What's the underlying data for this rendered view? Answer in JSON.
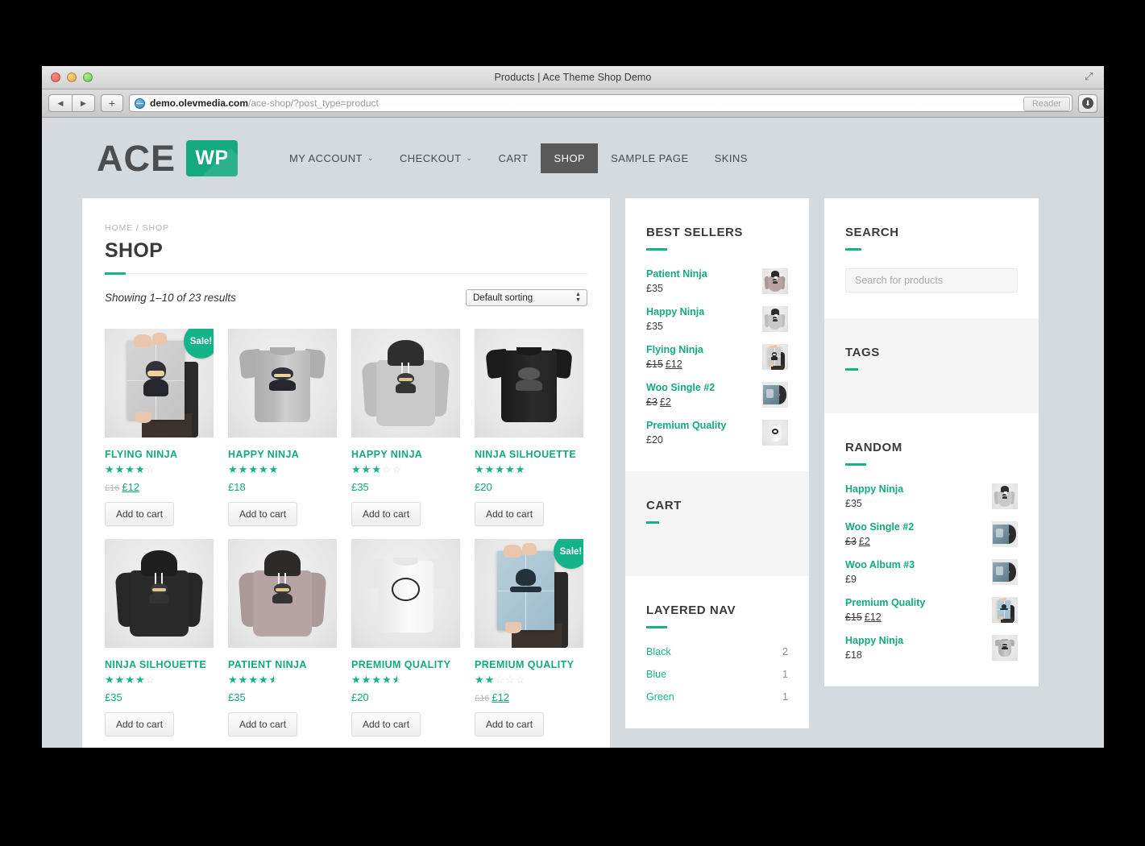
{
  "window": {
    "title": "Products | Ace Theme Shop Demo",
    "url_domain": "demo.olevmedia.com",
    "url_path": "/ace-shop/?post_type=product",
    "reader_label": "Reader",
    "reload_glyph": "↻",
    "back_glyph": "◀",
    "forward_glyph": "▶",
    "plus_glyph": "+",
    "download_glyph": "⬇",
    "resize_glyph": "⤢"
  },
  "header": {
    "logo_main": "ACE",
    "logo_badge": "WP",
    "nav": [
      {
        "label": "MY ACCOUNT",
        "has_caret": true,
        "active": false
      },
      {
        "label": "CHECKOUT",
        "has_caret": true,
        "active": false
      },
      {
        "label": "CART",
        "has_caret": false,
        "active": false
      },
      {
        "label": "SHOP",
        "has_caret": false,
        "active": true
      },
      {
        "label": "SAMPLE PAGE",
        "has_caret": false,
        "active": false
      },
      {
        "label": "SKINS",
        "has_caret": false,
        "active": false
      }
    ],
    "caret_glyph": "⌄"
  },
  "shop": {
    "breadcrumb": "HOME / SHOP",
    "title": "SHOP",
    "results_text": "Showing 1–10 of 23 results",
    "sort_selected": "Default sorting",
    "add_to_cart_label": "Add to cart",
    "sale_badge": "Sale!",
    "products": [
      {
        "name": "FLYING NINJA",
        "rating": 4,
        "price": "£12",
        "old_price": "£16",
        "on_sale": true,
        "art": "poster-gray"
      },
      {
        "name": "HAPPY NINJA",
        "rating": 5,
        "price": "£18",
        "old_price": "",
        "on_sale": false,
        "art": "shirt-gray"
      },
      {
        "name": "HAPPY NINJA",
        "rating": 3,
        "price": "£35",
        "old_price": "",
        "on_sale": false,
        "art": "hoodie-gray"
      },
      {
        "name": "NINJA SILHOUETTE",
        "rating": 5,
        "price": "£20",
        "old_price": "",
        "on_sale": false,
        "art": "shirt-black"
      },
      {
        "name": "NINJA SILHOUETTE",
        "rating": 4,
        "price": "£35",
        "old_price": "",
        "on_sale": false,
        "art": "hoodie-black"
      },
      {
        "name": "PATIENT NINJA",
        "rating": 4.5,
        "price": "£35",
        "old_price": "",
        "on_sale": false,
        "art": "hoodie-pink"
      },
      {
        "name": "PREMIUM QUALITY",
        "rating": 4.5,
        "price": "£20",
        "old_price": "",
        "on_sale": false,
        "art": "shirt-white"
      },
      {
        "name": "PREMIUM QUALITY",
        "rating": 2,
        "price": "£12",
        "old_price": "£16",
        "on_sale": true,
        "art": "poster-blue"
      }
    ]
  },
  "sidebar_mid": {
    "best_sellers": {
      "title": "BEST SELLERS",
      "items": [
        {
          "name": "Patient Ninja",
          "price": "£35",
          "old_price": "",
          "art": "hoodie-pink"
        },
        {
          "name": "Happy Ninja",
          "price": "£35",
          "old_price": "",
          "art": "hoodie-gray"
        },
        {
          "name": "Flying Ninja",
          "price": "£12",
          "old_price": "£15",
          "art": "poster-gray"
        },
        {
          "name": "Woo Single #2",
          "price": "£2",
          "old_price": "£3",
          "art": "vinyl"
        },
        {
          "name": "Premium Quality",
          "price": "£20",
          "old_price": "",
          "art": "shirt-white"
        }
      ]
    },
    "cart": {
      "title": "CART"
    },
    "layered_nav": {
      "title": "LAYERED NAV",
      "items": [
        {
          "label": "Black",
          "count": "2"
        },
        {
          "label": "Blue",
          "count": "1"
        },
        {
          "label": "Green",
          "count": "1"
        }
      ]
    }
  },
  "sidebar_right": {
    "search": {
      "title": "SEARCH",
      "placeholder": "Search for products",
      "value": ""
    },
    "tags": {
      "title": "TAGS"
    },
    "random": {
      "title": "RANDOM",
      "items": [
        {
          "name": "Happy Ninja",
          "price": "£35",
          "old_price": "",
          "art": "hoodie-gray"
        },
        {
          "name": "Woo Single #2",
          "price": "£2",
          "old_price": "£3",
          "art": "vinyl"
        },
        {
          "name": "Woo Album #3",
          "price": "£9",
          "old_price": "",
          "art": "vinyl"
        },
        {
          "name": "Premium Quality",
          "price": "£12",
          "old_price": "£15",
          "art": "poster-blue"
        },
        {
          "name": "Happy Ninja",
          "price": "£18",
          "old_price": "",
          "art": "shirt-gray"
        }
      ]
    }
  },
  "colors": {
    "accent_green": "#14b488",
    "link_green": "#14a97f",
    "nav_active_bg": "#595959",
    "page_bg": "#d5dade"
  }
}
